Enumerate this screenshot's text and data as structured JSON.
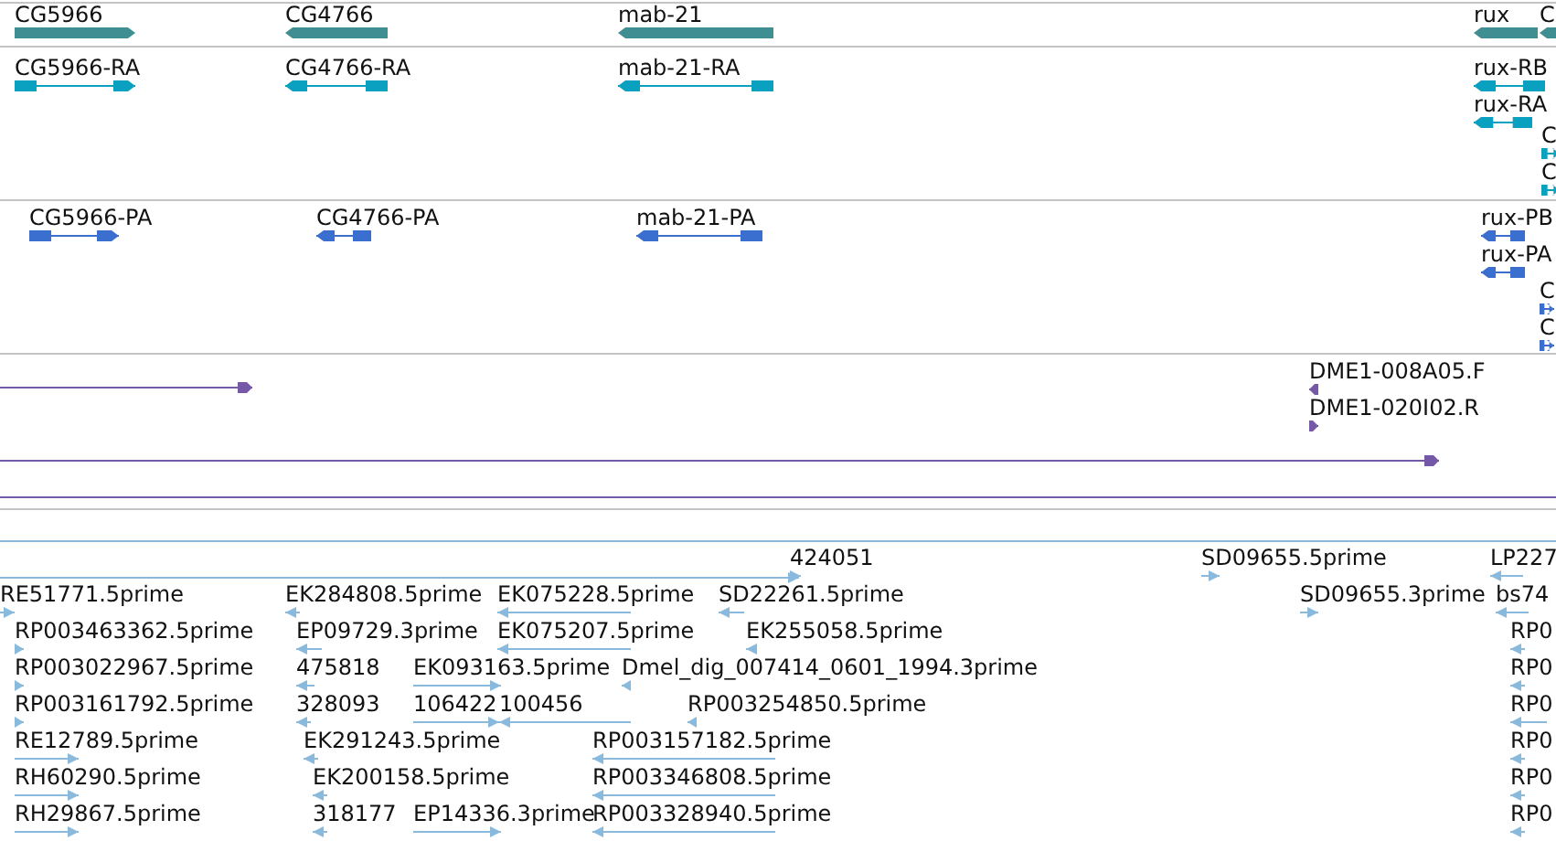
{
  "tracks": [
    {
      "kind": "gene",
      "features": [
        {
          "label": "CG5966",
          "reverse": false
        },
        {
          "label": "CG4766",
          "reverse": true
        },
        {
          "label": "mab-21",
          "reverse": true
        },
        {
          "label": "rux",
          "reverse": true
        },
        {
          "label": "C",
          "reverse": true
        }
      ]
    },
    {
      "kind": "transcript",
      "features": [
        {
          "label": "CG5966-RA",
          "reverse": false
        },
        {
          "label": "CG4766-RA",
          "reverse": true
        },
        {
          "label": "mab-21-RA",
          "reverse": true
        },
        {
          "label": "rux-RB",
          "reverse": true
        },
        {
          "label": "rux-RA",
          "reverse": true
        },
        {
          "label": "C",
          "reverse": false
        },
        {
          "label": "C",
          "reverse": false
        }
      ]
    },
    {
      "kind": "protein",
      "features": [
        {
          "label": "CG5966-PA",
          "reverse": false
        },
        {
          "label": "CG4766-PA",
          "reverse": true
        },
        {
          "label": "mab-21-PA",
          "reverse": true
        },
        {
          "label": "rux-PB",
          "reverse": true
        },
        {
          "label": "rux-PA",
          "reverse": true
        },
        {
          "label": "C",
          "reverse": false
        },
        {
          "label": "C",
          "reverse": false
        }
      ]
    },
    {
      "kind": "clone",
      "features": [
        {
          "reverse": false
        },
        {
          "label": "DME1-008A05.F",
          "reverse": true
        },
        {
          "label": "DME1-020I02.R",
          "reverse": false
        },
        {
          "reverse": false
        },
        {
          "reverse": false
        }
      ]
    },
    {
      "kind": "est",
      "features": [
        {
          "reverse": false
        },
        {
          "reverse": false
        },
        {
          "label": "424051",
          "reverse": false
        },
        {
          "label": "SD09655.5prime",
          "reverse": false
        },
        {
          "label": "LP227",
          "reverse": true
        },
        {
          "label": "RE51771.5prime",
          "reverse": false
        },
        {
          "label": "EK284808.5prime",
          "reverse": true
        },
        {
          "label": "EK075228.5prime",
          "reverse": true
        },
        {
          "label": "SD22261.5prime",
          "reverse": true
        },
        {
          "label": "SD09655.3prime",
          "reverse": false
        },
        {
          "label": "bs74",
          "reverse": true
        },
        {
          "label": "RP003463362.5prime",
          "reverse": false
        },
        {
          "label": "EP09729.3prime",
          "reverse": true
        },
        {
          "label": "EK075207.5prime",
          "reverse": true
        },
        {
          "label": "EK255058.5prime",
          "reverse": true
        },
        {
          "label": "RP0",
          "reverse": true
        },
        {
          "label": "RP003022967.5prime",
          "reverse": false
        },
        {
          "label": "475818",
          "reverse": true
        },
        {
          "label": "EK093163.5prime",
          "reverse": false
        },
        {
          "label": "Dmel_dig_007414_0601_1994.3prime",
          "reverse": true
        },
        {
          "label": "RP0",
          "reverse": true
        },
        {
          "label": "RP003161792.5prime",
          "reverse": false
        },
        {
          "label": "328093",
          "reverse": true
        },
        {
          "label": "106422",
          "reverse": false
        },
        {
          "label": "100456",
          "reverse": true
        },
        {
          "label": "RP003254850.5prime",
          "reverse": true
        },
        {
          "label": "RP0",
          "reverse": true
        },
        {
          "label": "RE12789.5prime",
          "reverse": false
        },
        {
          "label": "EK291243.5prime",
          "reverse": true
        },
        {
          "label": "RP003157182.5prime",
          "reverse": true
        },
        {
          "label": "RP0",
          "reverse": true
        },
        {
          "label": "RH60290.5prime",
          "reverse": false
        },
        {
          "label": "EK200158.5prime",
          "reverse": true
        },
        {
          "label": "RP003346808.5prime",
          "reverse": true
        },
        {
          "label": "RP0",
          "reverse": true
        },
        {
          "label": "RH29867.5prime",
          "reverse": false
        },
        {
          "label": "318177",
          "reverse": true
        },
        {
          "label": "EP14336.3prime",
          "reverse": false
        },
        {
          "label": "RP003328940.5prime",
          "reverse": true
        },
        {
          "label": "RP0",
          "reverse": true
        }
      ]
    }
  ]
}
